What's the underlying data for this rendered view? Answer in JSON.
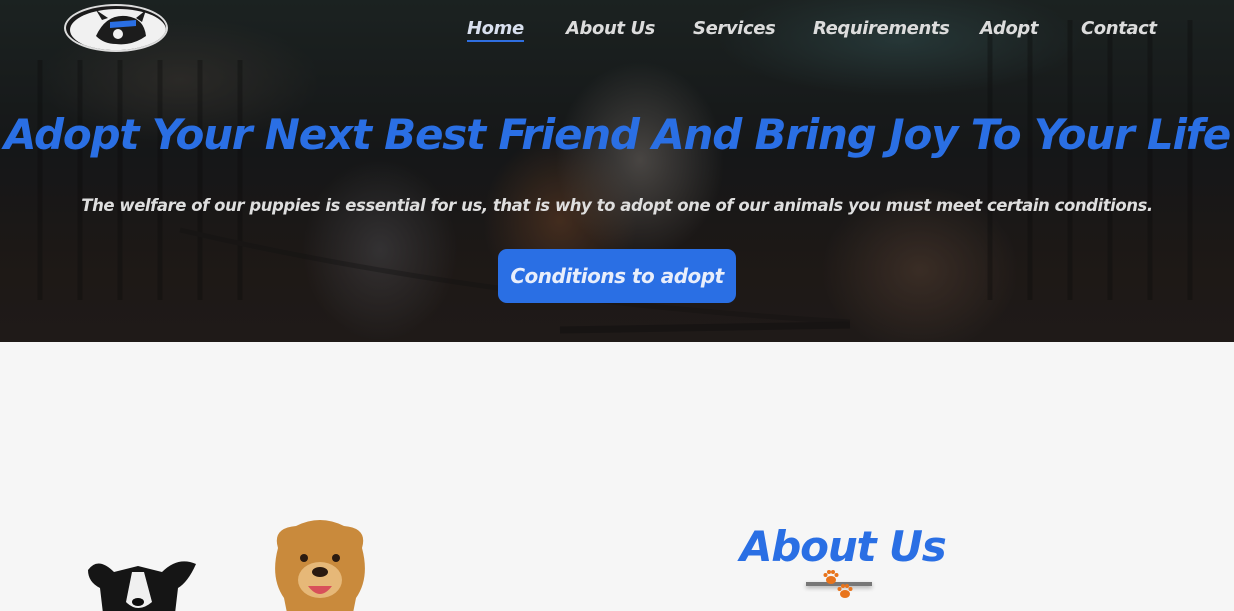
{
  "nav": {
    "items": [
      {
        "label": "Home",
        "active": true
      },
      {
        "label": "About Us",
        "active": false
      },
      {
        "label": "Services",
        "active": false
      },
      {
        "label": "Requirements",
        "active": false
      },
      {
        "label": "Adopt",
        "active": false
      },
      {
        "label": "Contact",
        "active": false
      }
    ]
  },
  "hero": {
    "title": "Adopt Your Next Best Friend And Bring Joy To Your Life",
    "subtitle": "The welfare of our puppies is essential for us, that is why to adopt one of our animals you must meet certain conditions.",
    "button_label": "Conditions to adopt"
  },
  "about": {
    "title": "About Us"
  },
  "icons": {
    "logo": "husky-dog-logo",
    "paw": "paw-print-icon"
  },
  "colors": {
    "accent": "#2a6fe4",
    "nav_text": "#dcdcdc",
    "paw": "#e8741c",
    "background": "#f6f6f6"
  }
}
